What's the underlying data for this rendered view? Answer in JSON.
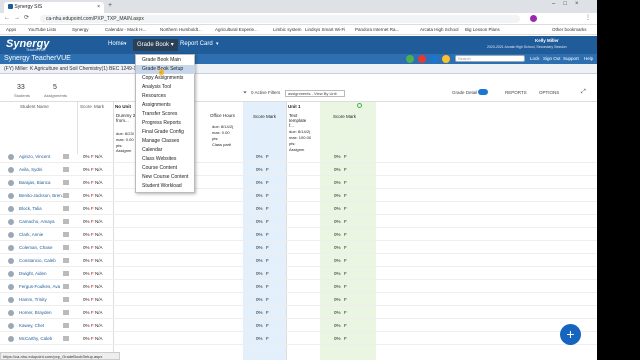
{
  "browser": {
    "tab_title": "Synergy SIS",
    "url": "ca-nhu.edupoint.com/PXP_TXP_MAIN.aspx",
    "bookmarks": [
      "Apps",
      "YouTube Lists",
      "Synergy",
      "Calendar - Mack H...",
      "Northern Humboldt...",
      "Agricultural Experie...",
      "Limbic system",
      "Lindsys Smart Wi-Fi",
      "Pandora Internet Ra...",
      "Arcata High School",
      "Big Lesson Plans",
      "Other bookmarks"
    ]
  },
  "app": {
    "logo": "Synergy",
    "logo_sub": "TeacherVUE",
    "nav": [
      "Home",
      "Grade Book",
      "Report Card"
    ],
    "user_name": "Kelly Miller",
    "user_school": "2020-2021 Arcata High School, Secondary Session",
    "subtitle": "Synergy TeacherVUE",
    "search_placeholder": "Search",
    "links": [
      "Lock",
      "Sign Out",
      "Support",
      "Help"
    ]
  },
  "classbar": {
    "text": "(FY) Miller: K Agriculture and Soil Chemistry(1) BEC 1249-1 (0)"
  },
  "stats": {
    "students": "33",
    "students_label": "Students",
    "assignments": "5",
    "assignments_label": "Assignments"
  },
  "toolbar": {
    "filters": "0 Active Filters",
    "view": "assignments - View By Unit",
    "grade_detail": "Grade Detail",
    "reports": "REPORTS",
    "options": "OPTIONS"
  },
  "grid": {
    "col_student": "Student Name",
    "col_score": "Score",
    "col_mark": "Mark",
    "unit_no": "No Unit",
    "unit_1": "Unit 1",
    "dummy": "Dummy 2 from...",
    "office_hours": "Office Hours",
    "text_template": "Text template f...",
    "score_mark": "Score Mark",
    "due_label": "due:",
    "due_1": "8/23/",
    "due_2": "8/14/2(",
    "due_3": "8/14/2(",
    "max_label": "max:",
    "max_val": "0.00",
    "max_val2": "100.00",
    "pts_label": "pts:",
    "assign_label": "Assignm",
    "class_part": "Class parti",
    "students": [
      "Aginzo, Vincent",
      "Avila, Sydni",
      "Barajas, Bianca",
      "Benito-Jackson, Bren...",
      "Block, Talia",
      "Camacho, Amaya",
      "Clark, Annie",
      "Coleman, Chase",
      "Constancio, Caleb",
      "Dwight, Aiden",
      "Fergus-Foulkes, Ava",
      "Hamm, Trinity",
      "Homer, Brayden",
      "Kawey, Chet",
      "McCarthy, Caleb"
    ],
    "pct": "0%",
    "mark_f": "F",
    "na": "N/A",
    "one": "1",
    "zero": "0"
  },
  "menu": {
    "items": [
      "Grade Book Main",
      "Grade Book Setup",
      "Copy Assignments",
      "Analysis Tool",
      "Resources",
      "Assignments",
      "Transfer Scores",
      "Progress Reports",
      "Final Grade Config",
      "Manage Classes",
      "Calendar",
      "Class Websites",
      "Course Content",
      "New Course Content",
      "Student Workload"
    ],
    "highlighted": 1
  },
  "statusbar": {
    "text": "https://ca-nhu.edupoint.com/pxp_GradeBookSetup.aspx"
  },
  "fab": {
    "label": "+"
  }
}
